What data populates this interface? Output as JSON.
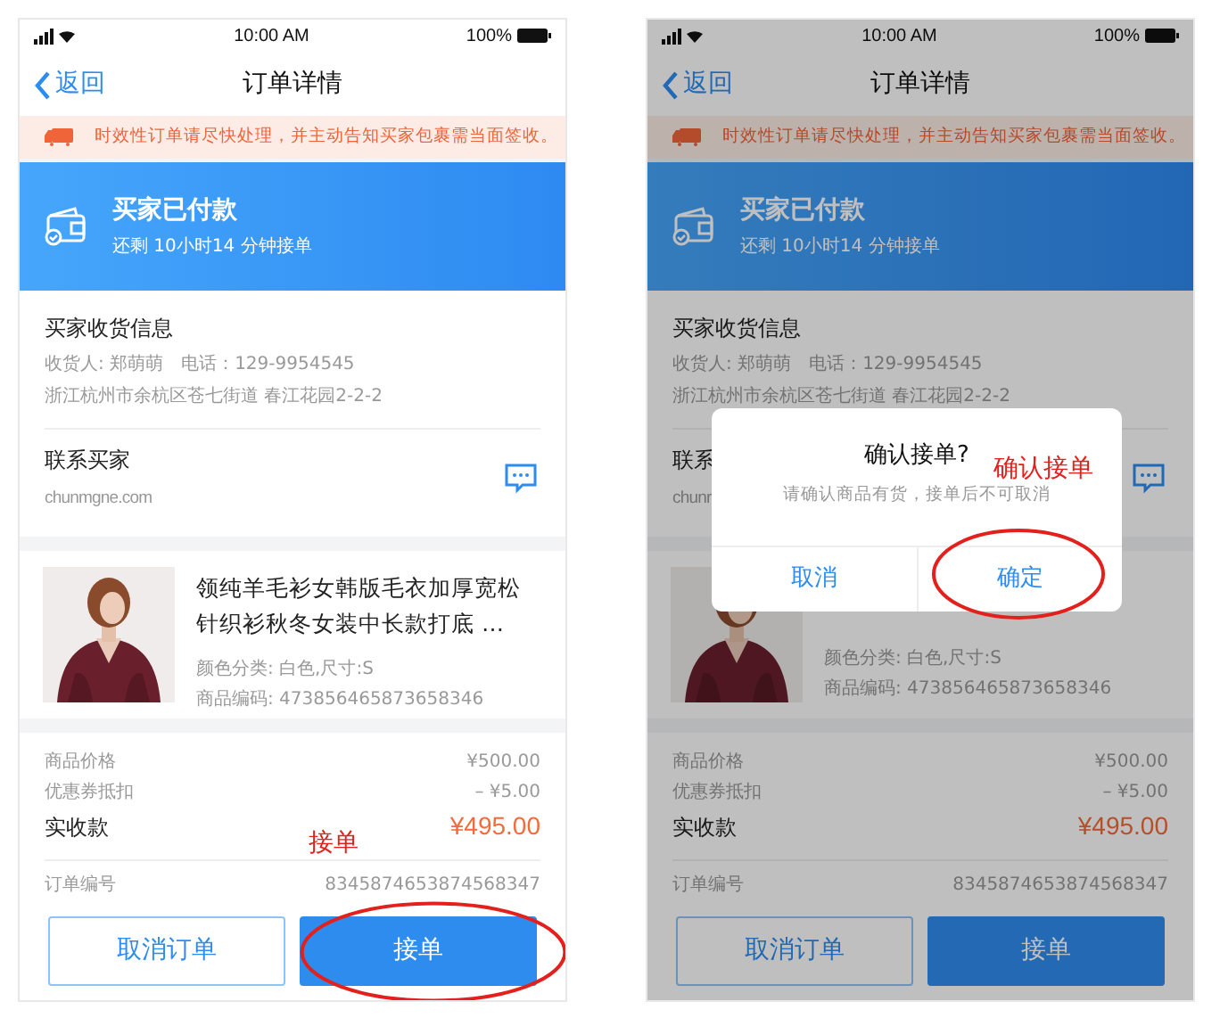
{
  "screens": [
    {
      "status_bar": {
        "time": "10:00 AM",
        "battery": "100%"
      },
      "nav": {
        "back": "返回",
        "title": "订单详情"
      },
      "notice": "时效性订单请尽快处理，并主动告知买家包裹需当面签收。",
      "banner": {
        "title": "买家已付款",
        "subtitle": "还剩 10小时14 分钟接单"
      },
      "buyer": {
        "heading": "买家收货信息",
        "recipient": "收货人: 郑萌萌",
        "phone": "电话：129-9954545",
        "address": "浙江杭州市余杭区苍七街道 春江花园2-2-2",
        "contact_label": "联系买家",
        "contact_site": "chunmgne.com"
      },
      "product": {
        "kind": "picture",
        "title_lines": [
          "领纯羊毛衫女韩版毛衣加厚宽松",
          "针织衫秋冬女装中长款打底 …"
        ],
        "spec": "颜色分类: 白色,尺寸:S",
        "code": "商品编码: 473856465873658346"
      },
      "prices": [
        {
          "label": "商品价格",
          "value": "¥500.00"
        },
        {
          "label": "优惠券抵扣",
          "value": "– ¥5.00"
        }
      ],
      "total": {
        "label": "实收款",
        "value": "¥495.00"
      },
      "order_number": {
        "label": "订单编号",
        "value": "8345874653874568347"
      },
      "buttons": {
        "secondary": "取消订单",
        "primary": "接单",
        "annotation": "接单"
      },
      "dimmed": false
    },
    {
      "status_bar": {
        "time": "10:00 AM",
        "battery": "100%"
      },
      "nav": {
        "back": "返回",
        "title": "订单详情"
      },
      "notice": "时效性订单请尽快处理，并主动告知买家包裹需当面签收。",
      "banner": {
        "title": "买家已付款",
        "subtitle": "还剩 10小时14 分钟接单"
      },
      "buyer": {
        "heading": "买家收货信息",
        "recipient": "收货人: 郑萌萌",
        "phone": "电话：129-9954545",
        "address": "浙江杭州市余杭区苍七街道 春江花园2-2-2",
        "contact_label": "联系",
        "contact_site": "chunr"
      },
      "product": {
        "kind": "picture",
        "spec": "颜色分类: 白色,尺寸:S",
        "code": "商品编码: 473856465873658346"
      },
      "prices": [
        {
          "label": "商品价格",
          "value": "¥500.00"
        },
        {
          "label": "优惠券抵扣",
          "value": "– ¥5.00"
        }
      ],
      "total": {
        "label": "实收款",
        "value": "¥495.00"
      },
      "order_number": {
        "label": "订单编号",
        "value": "8345874653874568347"
      },
      "buttons": {
        "secondary": "取消订单",
        "primary": "接单"
      },
      "dimmed": true,
      "dialog": {
        "title": "确认接单?",
        "message": "请确认商品有货，接单后不可取消",
        "cancel": "取消",
        "confirm": "确定",
        "annotation": "确认接单"
      }
    }
  ]
}
